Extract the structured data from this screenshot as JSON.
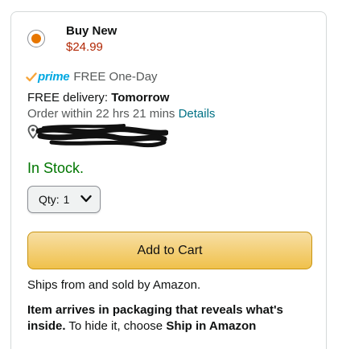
{
  "offer": {
    "title": "Buy New",
    "price": "$24.99",
    "selected": true
  },
  "prime": {
    "brand": "prime",
    "tagline": "FREE One-Day"
  },
  "delivery": {
    "prefix": "FREE delivery: ",
    "day": "Tomorrow",
    "order_within": "Order within 22 hrs 21 mins ",
    "details_link": "Details"
  },
  "location": {
    "icon": "location-pin-icon",
    "redacted": true
  },
  "stock_status": "In Stock.",
  "quantity": {
    "label": "Qty:",
    "value": "1"
  },
  "add_to_cart_label": "Add to Cart",
  "ships_from": "Ships from and sold by Amazon.",
  "packaging_notice": {
    "bold_text": "Item arrives in packaging that reveals what's inside.",
    "text": " To hide it, choose ",
    "bold_link": "Ship in Amazon"
  },
  "colors": {
    "price": "#b12704",
    "in_stock": "#007600",
    "link": "#007185",
    "prime": "#00a8e1",
    "radio_selected": "#e77600",
    "add_to_cart": "#f0c14b"
  }
}
